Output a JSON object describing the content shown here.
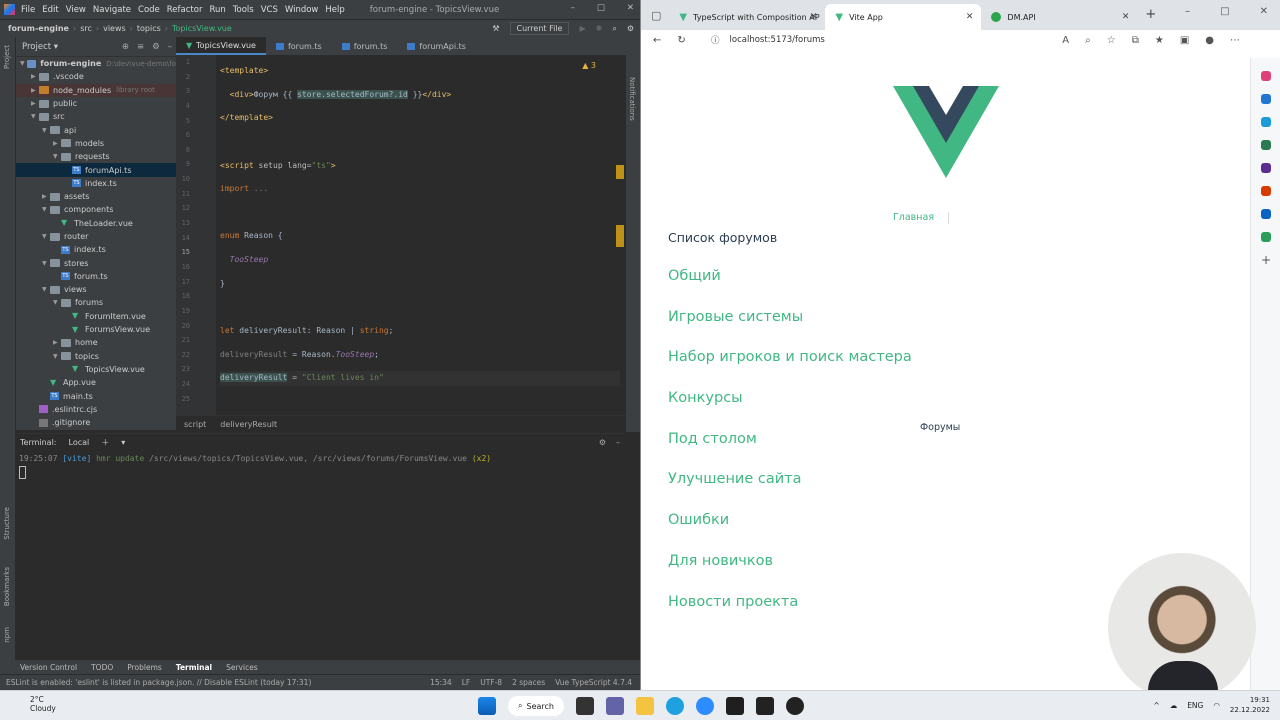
{
  "ide": {
    "menu": [
      "File",
      "Edit",
      "View",
      "Navigate",
      "Code",
      "Refactor",
      "Run",
      "Tools",
      "VCS",
      "Window",
      "Help"
    ],
    "window_title": "forum-engine - TopicsView.vue",
    "nav": {
      "project": "forum-engine",
      "crumbs": [
        "src",
        "views",
        "topics",
        "TopicsView.vue"
      ],
      "run_config": "Current File"
    },
    "project_panel": {
      "title": "Project",
      "items": [
        {
          "label": "forum-engine",
          "extra": "D:\\dev\\vue-demo\\fo",
          "depth": 0,
          "kind": "folder",
          "open": true
        },
        {
          "label": ".vscode",
          "depth": 1,
          "kind": "folder"
        },
        {
          "label": "node_modules",
          "extra": "library root",
          "depth": 1,
          "kind": "folder-orange",
          "lib": true
        },
        {
          "label": "public",
          "depth": 1,
          "kind": "folder"
        },
        {
          "label": "src",
          "depth": 1,
          "kind": "folder",
          "open": true
        },
        {
          "label": "api",
          "depth": 2,
          "kind": "folder",
          "open": true
        },
        {
          "label": "models",
          "depth": 3,
          "kind": "folder"
        },
        {
          "label": "requests",
          "depth": 3,
          "kind": "folder",
          "open": true
        },
        {
          "label": "forumApi.ts",
          "depth": 4,
          "kind": "ts",
          "selected": true
        },
        {
          "label": "index.ts",
          "depth": 4,
          "kind": "ts"
        },
        {
          "label": "assets",
          "depth": 2,
          "kind": "folder"
        },
        {
          "label": "components",
          "depth": 2,
          "kind": "folder",
          "open": true
        },
        {
          "label": "TheLoader.vue",
          "depth": 3,
          "kind": "vue"
        },
        {
          "label": "router",
          "depth": 2,
          "kind": "folder",
          "open": true
        },
        {
          "label": "index.ts",
          "depth": 3,
          "kind": "ts"
        },
        {
          "label": "stores",
          "depth": 2,
          "kind": "folder",
          "open": true
        },
        {
          "label": "forum.ts",
          "depth": 3,
          "kind": "ts"
        },
        {
          "label": "views",
          "depth": 2,
          "kind": "folder",
          "open": true
        },
        {
          "label": "forums",
          "depth": 3,
          "kind": "folder",
          "open": true
        },
        {
          "label": "ForumItem.vue",
          "depth": 4,
          "kind": "vue"
        },
        {
          "label": "ForumsView.vue",
          "depth": 4,
          "kind": "vue"
        },
        {
          "label": "home",
          "depth": 3,
          "kind": "folder"
        },
        {
          "label": "topics",
          "depth": 3,
          "kind": "folder",
          "open": true
        },
        {
          "label": "TopicsView.vue",
          "depth": 4,
          "kind": "vue"
        },
        {
          "label": "App.vue",
          "depth": 2,
          "kind": "vue"
        },
        {
          "label": "main.ts",
          "depth": 2,
          "kind": "ts"
        },
        {
          "label": ".eslintrc.cjs",
          "depth": 1,
          "kind": "js"
        },
        {
          "label": ".gitignore",
          "depth": 1,
          "kind": "file"
        }
      ]
    },
    "tabs": [
      {
        "label": "TopicsView.vue",
        "kind": "vue",
        "active": true
      },
      {
        "label": "forum.ts",
        "kind": "ts"
      },
      {
        "label": "forum.ts",
        "kind": "ts"
      },
      {
        "label": "forumApi.ts",
        "kind": "ts"
      }
    ],
    "warning_count": "3",
    "line_numbers": [
      "1",
      "2",
      "3",
      "4",
      "5",
      "6",
      "8",
      "9",
      "10",
      "11",
      "12",
      "13",
      "14",
      "15",
      "16",
      "17",
      "18",
      "19",
      "20",
      "21",
      "22",
      "23",
      "24",
      "25"
    ],
    "breadcrumb": [
      "script",
      "deliveryResult"
    ],
    "terminal": {
      "title": "Terminal:",
      "tab": "Local",
      "time": "19:25:07",
      "tag": "[vite]",
      "msg": "hmr update",
      "paths": "/src/views/topics/TopicsView.vue, /src/views/forums/ForumsView.vue",
      "count": "(x2)"
    },
    "tool_tabs": [
      "Version Control",
      "TODO",
      "Problems",
      "Terminal",
      "Services"
    ],
    "status": {
      "msg": "ESLint is enabled: 'eslint' is listed in package.json. // Disable ESLint (today 17:31)",
      "pos": "15:34",
      "le": "LF",
      "enc": "UTF-8",
      "indent": "2 spaces",
      "lang": "Vue TypeScript 4.7.4"
    },
    "side_labels": {
      "project": "Project",
      "structure": "Structure",
      "bookmarks": "Bookmarks",
      "npm": "npm",
      "notifications": "Notifications"
    }
  },
  "browser": {
    "tabs": [
      {
        "label": "TypeScript with Composition AP",
        "kind": "vue"
      },
      {
        "label": "Vite App",
        "kind": "vue",
        "active": true
      },
      {
        "label": "DM.API",
        "kind": "dm"
      }
    ],
    "url": "localhost:5173/forums",
    "nav": {
      "home": "Главная",
      "forums": "Форумы"
    },
    "heading": "Список форумов",
    "forums": [
      "Общий",
      "Игровые системы",
      "Набор игроков и поиск мастера",
      "Конкурсы",
      "Под столом",
      "Улучшение сайта",
      "Ошибки",
      "Для новичков",
      "Новости проекта"
    ],
    "colors": {
      "accent": "#41b883",
      "text": "#2c3e50"
    }
  },
  "taskbar": {
    "weather": {
      "temp": "2°C",
      "cond": "Cloudy"
    },
    "search": "Search",
    "lang": "ENG",
    "time": "19:31",
    "date": "22.12.2022"
  }
}
